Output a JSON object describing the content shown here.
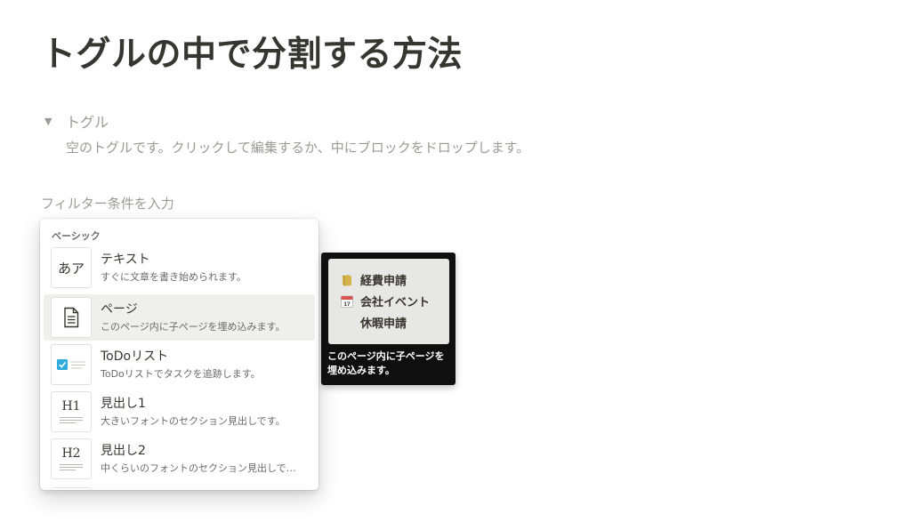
{
  "page": {
    "title": "トグルの中で分割する方法"
  },
  "toggle": {
    "label": "トグル",
    "hint": "空のトグルです。クリックして編集するか、中にブロックをドロップします。",
    "arrow_icon": "triangle-down-icon"
  },
  "filter": {
    "placeholder": "フィルター条件を入力",
    "value": ""
  },
  "menu": {
    "section_label": "ベーシック",
    "items": [
      {
        "title": "テキスト",
        "description": "すぐに文章を書き始められます。",
        "thumb_text": "あア",
        "icon": "text-icon"
      },
      {
        "title": "ページ",
        "description": "このページ内に子ページを埋め込みます。",
        "icon": "page-icon"
      },
      {
        "title": "ToDoリスト",
        "description": "ToDoリストでタスクを追跡します。",
        "icon": "checkbox-icon"
      },
      {
        "title": "見出し1",
        "description": "大きいフォントのセクション見出しです。",
        "thumb_text": "H1",
        "icon": "heading1-icon"
      },
      {
        "title": "見出し2",
        "description": "中くらいのフォントのセクション見出しで…",
        "thumb_text": "H2",
        "icon": "heading2-icon"
      }
    ],
    "selected_index": 1
  },
  "preview": {
    "rows": [
      {
        "label": "経費申請",
        "icon": "folder-icon"
      },
      {
        "label": "会社イベント",
        "icon": "calendar-icon",
        "icon_text": "17"
      },
      {
        "label": "休暇申請",
        "icon": ""
      }
    ],
    "caption": "このページ内に子ページを埋め込みます。"
  },
  "colors": {
    "text": "#37352f",
    "muted": "#9b9a97",
    "selected_bg": "#efefee",
    "preview_bg": "#0f0f0f",
    "checkbox_blue": "#2eaadc",
    "folder_gold": "#d4b44a"
  }
}
